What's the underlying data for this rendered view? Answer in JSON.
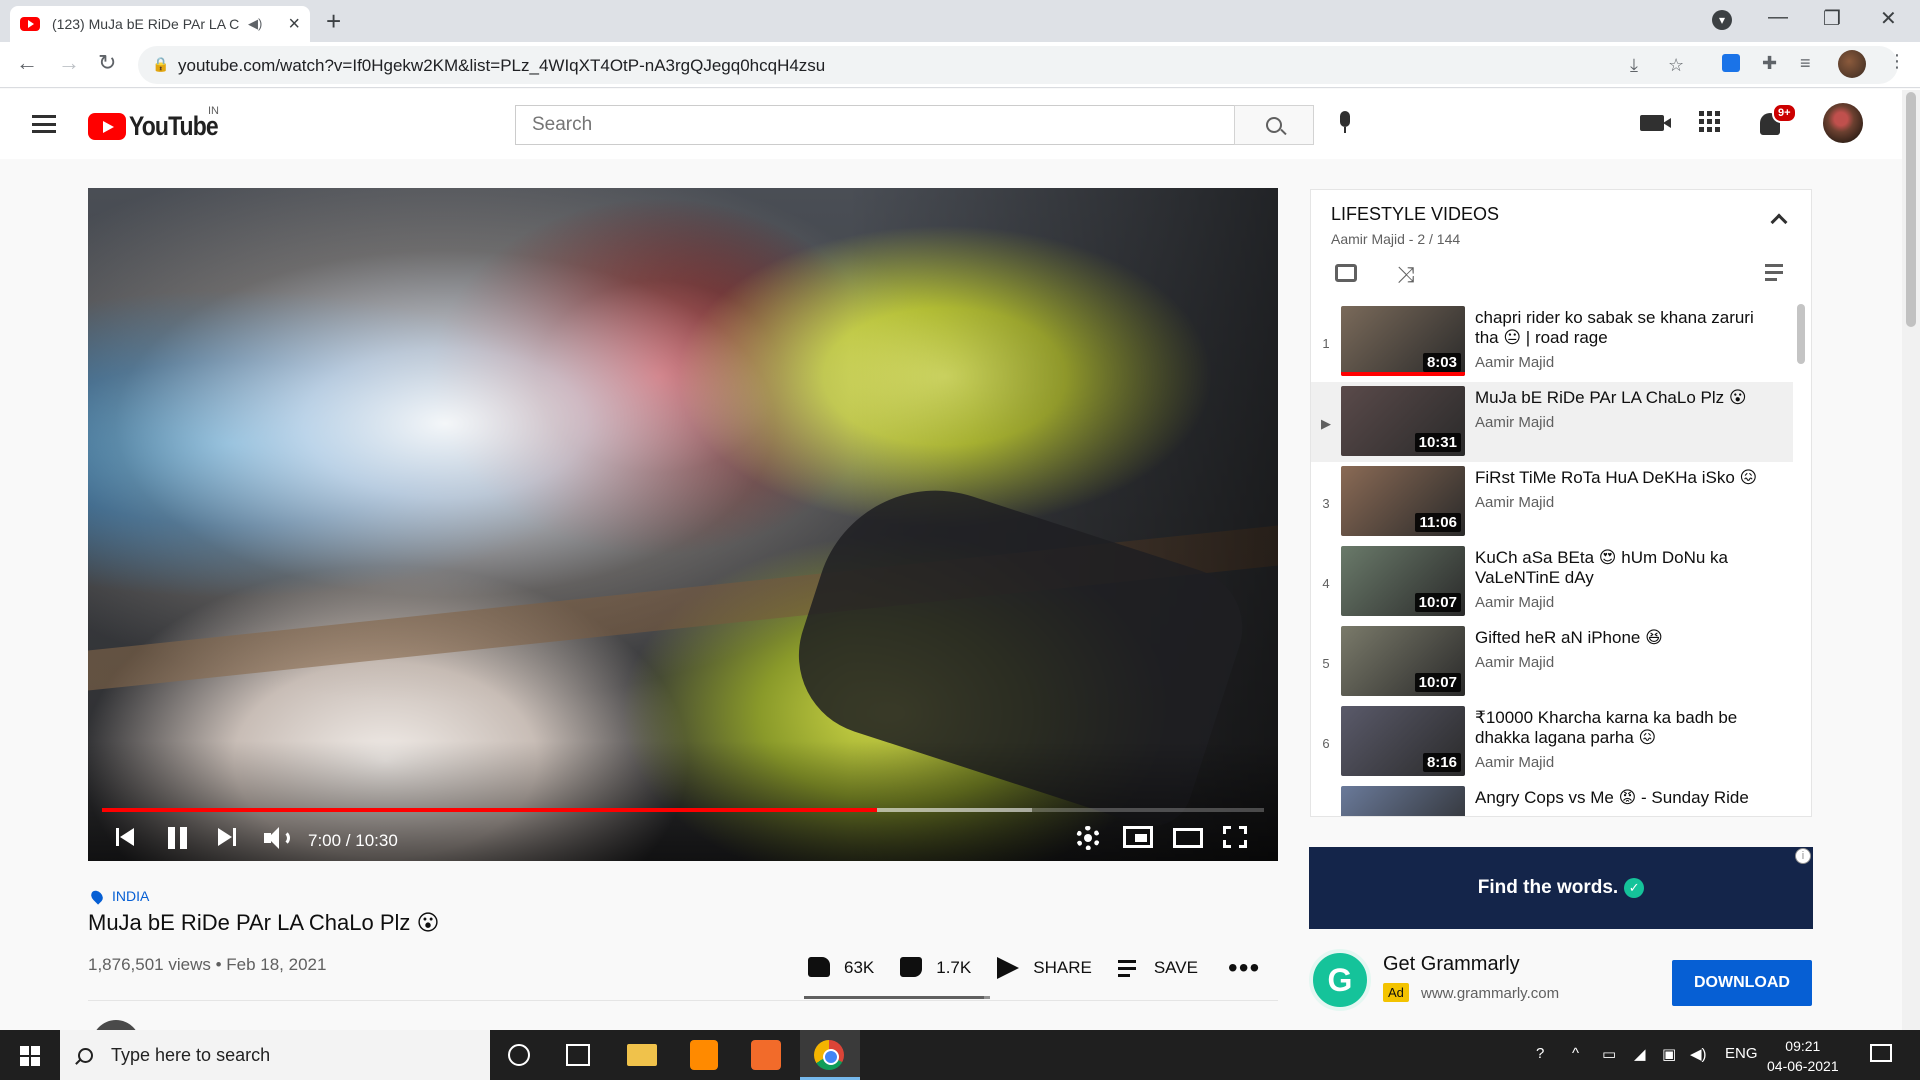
{
  "browser": {
    "tab_title": "(123) MuJa bE RiDe PAr LA C",
    "url": "youtube.com/watch?v=If0Hgekw2KM&list=PLz_4WIqXT4OtP-nA3rgQJegq0hcqH4zsu"
  },
  "youtube": {
    "logo_text": "YouTube",
    "country_code": "IN",
    "search_placeholder": "Search",
    "notification_count": "9+"
  },
  "player": {
    "time_display": "7:00 / 10:30",
    "played_fraction": 0.667,
    "buffered_fraction": 0.8
  },
  "video": {
    "location": "INDIA",
    "title": "MuJa bE RiDe PAr LA ChaLo Plz 😮",
    "meta": "1,876,501 views • Feb 18, 2021",
    "likes": "63K",
    "dislikes": "1.7K",
    "share_label": "SHARE",
    "save_label": "SAVE"
  },
  "playlist": {
    "title": "LIFESTYLE VIDEOS",
    "subtitle": "Aamir Majid - 2 / 144",
    "items": [
      {
        "index": "1",
        "title": "chapri rider ko sabak se khana zaruri tha 😐 | road rage",
        "channel": "Aamir Majid",
        "duration": "8:03",
        "active": false,
        "thumb": "#7a6a5a"
      },
      {
        "index": "▶",
        "title": "MuJa bE RiDe PAr LA ChaLo Plz 😮",
        "channel": "Aamir Majid",
        "duration": "10:31",
        "active": true,
        "thumb": "#5a4a4a"
      },
      {
        "index": "3",
        "title": "FiRst TiMe RoTa HuA DeKHa iSko 😖",
        "channel": "Aamir Majid",
        "duration": "11:06",
        "active": false,
        "thumb": "#8a6a55"
      },
      {
        "index": "4",
        "title": "KuCh aSa BEta 😍 hUm DoNu ka VaLeNTinE dAy",
        "channel": "Aamir Majid",
        "duration": "10:07",
        "active": false,
        "thumb": "#6a7a6a"
      },
      {
        "index": "5",
        "title": "Gifted heR aN iPhone 😆",
        "channel": "Aamir Majid",
        "duration": "10:07",
        "active": false,
        "thumb": "#7a7a6a"
      },
      {
        "index": "6",
        "title": "₹10000 Kharcha karna ka badh be dhakka lagana parha 😖",
        "channel": "Aamir Majid",
        "duration": "8:16",
        "active": false,
        "thumb": "#5a5a6a"
      },
      {
        "index": "",
        "title": "Angry Cops vs Me 😡 - Sunday Ride",
        "channel": "",
        "duration": "",
        "active": false,
        "thumb": "#6a7a9a"
      }
    ]
  },
  "ad": {
    "banner_text": "Find the words.",
    "info": "i",
    "logo_letter": "G",
    "title": "Get Grammarly",
    "tag": "Ad",
    "url": "www.grammarly.com",
    "cta": "DOWNLOAD"
  },
  "taskbar": {
    "search_placeholder": "Type here to search",
    "language": "ENG",
    "time": "09:21",
    "date": "04-06-2021"
  },
  "colors": {
    "youtube_red": "#ff0000",
    "link_blue": "#065fd4",
    "grammarly_green": "#15c39a",
    "ad_navy": "#14254a"
  }
}
